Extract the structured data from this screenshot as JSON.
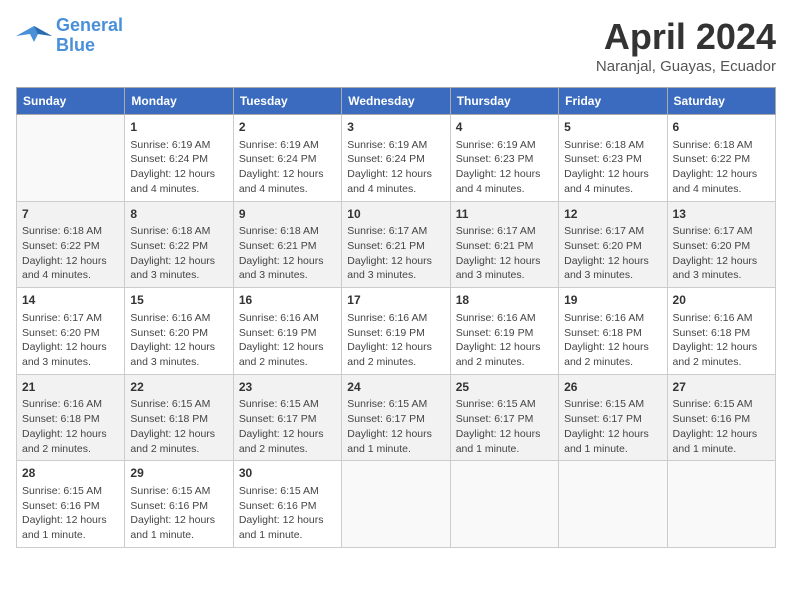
{
  "logo": {
    "line1": "General",
    "line2": "Blue"
  },
  "title": "April 2024",
  "subtitle": "Naranjal, Guayas, Ecuador",
  "days_of_week": [
    "Sunday",
    "Monday",
    "Tuesday",
    "Wednesday",
    "Thursday",
    "Friday",
    "Saturday"
  ],
  "weeks": [
    [
      {
        "num": "",
        "info": ""
      },
      {
        "num": "1",
        "info": "Sunrise: 6:19 AM\nSunset: 6:24 PM\nDaylight: 12 hours\nand 4 minutes."
      },
      {
        "num": "2",
        "info": "Sunrise: 6:19 AM\nSunset: 6:24 PM\nDaylight: 12 hours\nand 4 minutes."
      },
      {
        "num": "3",
        "info": "Sunrise: 6:19 AM\nSunset: 6:24 PM\nDaylight: 12 hours\nand 4 minutes."
      },
      {
        "num": "4",
        "info": "Sunrise: 6:19 AM\nSunset: 6:23 PM\nDaylight: 12 hours\nand 4 minutes."
      },
      {
        "num": "5",
        "info": "Sunrise: 6:18 AM\nSunset: 6:23 PM\nDaylight: 12 hours\nand 4 minutes."
      },
      {
        "num": "6",
        "info": "Sunrise: 6:18 AM\nSunset: 6:22 PM\nDaylight: 12 hours\nand 4 minutes."
      }
    ],
    [
      {
        "num": "7",
        "info": "Sunrise: 6:18 AM\nSunset: 6:22 PM\nDaylight: 12 hours\nand 4 minutes."
      },
      {
        "num": "8",
        "info": "Sunrise: 6:18 AM\nSunset: 6:22 PM\nDaylight: 12 hours\nand 3 minutes."
      },
      {
        "num": "9",
        "info": "Sunrise: 6:18 AM\nSunset: 6:21 PM\nDaylight: 12 hours\nand 3 minutes."
      },
      {
        "num": "10",
        "info": "Sunrise: 6:17 AM\nSunset: 6:21 PM\nDaylight: 12 hours\nand 3 minutes."
      },
      {
        "num": "11",
        "info": "Sunrise: 6:17 AM\nSunset: 6:21 PM\nDaylight: 12 hours\nand 3 minutes."
      },
      {
        "num": "12",
        "info": "Sunrise: 6:17 AM\nSunset: 6:20 PM\nDaylight: 12 hours\nand 3 minutes."
      },
      {
        "num": "13",
        "info": "Sunrise: 6:17 AM\nSunset: 6:20 PM\nDaylight: 12 hours\nand 3 minutes."
      }
    ],
    [
      {
        "num": "14",
        "info": "Sunrise: 6:17 AM\nSunset: 6:20 PM\nDaylight: 12 hours\nand 3 minutes."
      },
      {
        "num": "15",
        "info": "Sunrise: 6:16 AM\nSunset: 6:20 PM\nDaylight: 12 hours\nand 3 minutes."
      },
      {
        "num": "16",
        "info": "Sunrise: 6:16 AM\nSunset: 6:19 PM\nDaylight: 12 hours\nand 2 minutes."
      },
      {
        "num": "17",
        "info": "Sunrise: 6:16 AM\nSunset: 6:19 PM\nDaylight: 12 hours\nand 2 minutes."
      },
      {
        "num": "18",
        "info": "Sunrise: 6:16 AM\nSunset: 6:19 PM\nDaylight: 12 hours\nand 2 minutes."
      },
      {
        "num": "19",
        "info": "Sunrise: 6:16 AM\nSunset: 6:18 PM\nDaylight: 12 hours\nand 2 minutes."
      },
      {
        "num": "20",
        "info": "Sunrise: 6:16 AM\nSunset: 6:18 PM\nDaylight: 12 hours\nand 2 minutes."
      }
    ],
    [
      {
        "num": "21",
        "info": "Sunrise: 6:16 AM\nSunset: 6:18 PM\nDaylight: 12 hours\nand 2 minutes."
      },
      {
        "num": "22",
        "info": "Sunrise: 6:15 AM\nSunset: 6:18 PM\nDaylight: 12 hours\nand 2 minutes."
      },
      {
        "num": "23",
        "info": "Sunrise: 6:15 AM\nSunset: 6:17 PM\nDaylight: 12 hours\nand 2 minutes."
      },
      {
        "num": "24",
        "info": "Sunrise: 6:15 AM\nSunset: 6:17 PM\nDaylight: 12 hours\nand 1 minute."
      },
      {
        "num": "25",
        "info": "Sunrise: 6:15 AM\nSunset: 6:17 PM\nDaylight: 12 hours\nand 1 minute."
      },
      {
        "num": "26",
        "info": "Sunrise: 6:15 AM\nSunset: 6:17 PM\nDaylight: 12 hours\nand 1 minute."
      },
      {
        "num": "27",
        "info": "Sunrise: 6:15 AM\nSunset: 6:16 PM\nDaylight: 12 hours\nand 1 minute."
      }
    ],
    [
      {
        "num": "28",
        "info": "Sunrise: 6:15 AM\nSunset: 6:16 PM\nDaylight: 12 hours\nand 1 minute."
      },
      {
        "num": "29",
        "info": "Sunrise: 6:15 AM\nSunset: 6:16 PM\nDaylight: 12 hours\nand 1 minute."
      },
      {
        "num": "30",
        "info": "Sunrise: 6:15 AM\nSunset: 6:16 PM\nDaylight: 12 hours\nand 1 minute."
      },
      {
        "num": "",
        "info": ""
      },
      {
        "num": "",
        "info": ""
      },
      {
        "num": "",
        "info": ""
      },
      {
        "num": "",
        "info": ""
      }
    ]
  ]
}
